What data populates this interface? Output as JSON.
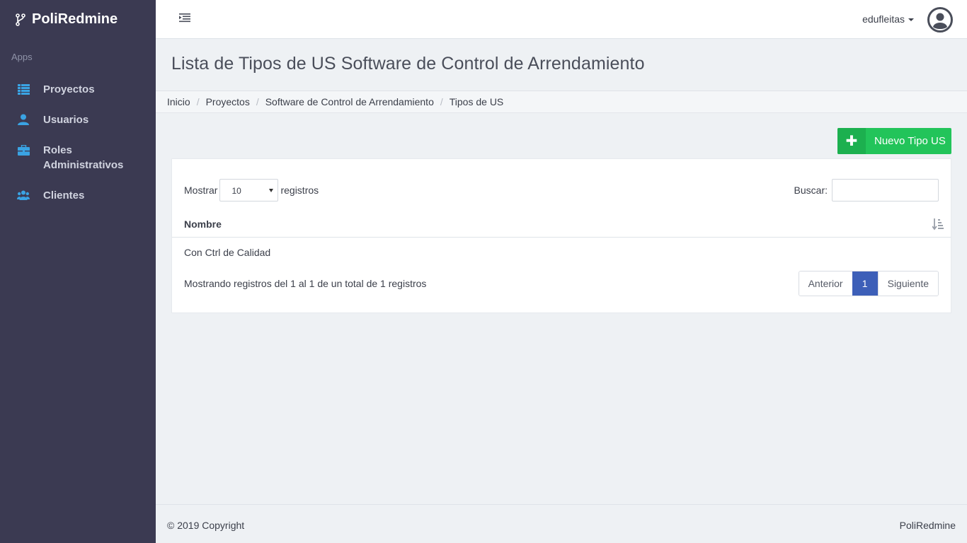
{
  "app": {
    "name": "PoliRedmine"
  },
  "sidebar": {
    "section_title": "Apps",
    "items": [
      {
        "label": "Proyectos",
        "icon": "list-icon"
      },
      {
        "label": "Usuarios",
        "icon": "user-icon"
      },
      {
        "label": "Roles Administrativos",
        "icon": "briefcase-icon"
      },
      {
        "label": "Clientes",
        "icon": "users-icon"
      }
    ],
    "accent_color": "#3aa3e3"
  },
  "topbar": {
    "username": "edufleitas"
  },
  "page": {
    "title": "Lista de Tipos de US Software de Control de Arrendamiento"
  },
  "breadcrumb": [
    "Inicio",
    "Proyectos",
    "Software de Control de Arrendamiento",
    "Tipos de US"
  ],
  "actions": {
    "new_button": "Nuevo Tipo US",
    "new_button_color": "#22c45a"
  },
  "table": {
    "length_label_before": "Mostrar",
    "length_value": "10",
    "length_label_after": "registros",
    "search_label": "Buscar:",
    "search_value": "",
    "columns": [
      "Nombre"
    ],
    "rows": [
      [
        "Con Ctrl de Calidad"
      ]
    ],
    "info": "Mostrando registros del 1 al 1 de un total de 1 registros",
    "pagination": {
      "previous": "Anterior",
      "current": "1",
      "next": "Siguiente"
    }
  },
  "footer": {
    "copyright": "© 2019 Copyright",
    "brand": "PoliRedmine"
  }
}
